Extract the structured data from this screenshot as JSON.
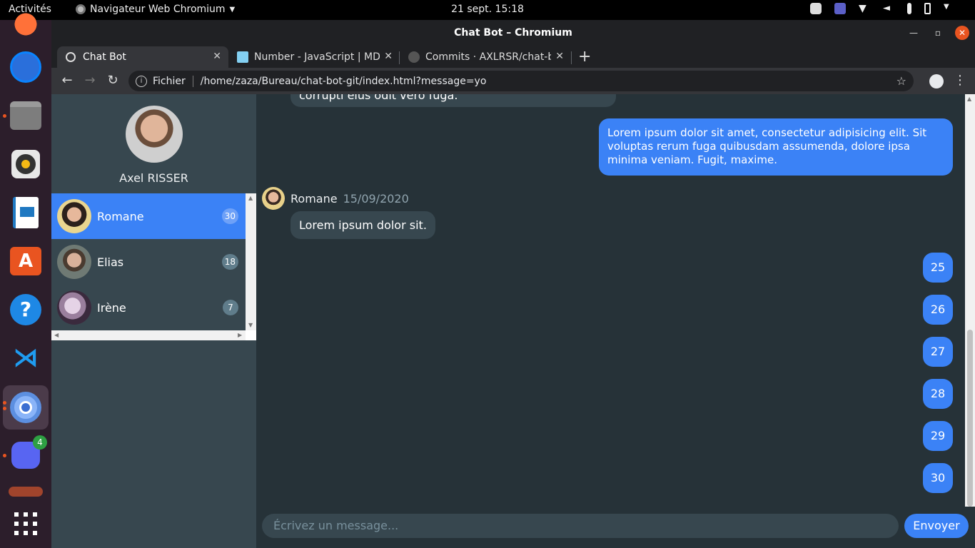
{
  "topbar": {
    "activities": "Activités",
    "app_name": "Navigateur Web Chromium",
    "clock": "21 sept.  15:18"
  },
  "dock": {
    "discord_badge": "4"
  },
  "window": {
    "title": "Chat Bot – Chromium"
  },
  "tabs": [
    {
      "label": "Chat Bot"
    },
    {
      "label": "Number - JavaScript | MDN"
    },
    {
      "label": "Commits · AXLRSR/chat-b"
    }
  ],
  "omnibox": {
    "scheme": "Fichier",
    "url": "/home/zaza/Bureau/chat-bot-git/index.html?message=yo"
  },
  "profile": {
    "name": "Axel RISSER"
  },
  "contacts": [
    {
      "name": "Romane",
      "count": "30"
    },
    {
      "name": "Elias",
      "count": "18"
    },
    {
      "name": "Irène",
      "count": "7"
    }
  ],
  "chat": {
    "partial_message": "corrupti eius odit vero fuga.",
    "my_message": "Lorem ipsum dolor sit amet, consectetur adipisicing elit. Sit voluptas rerum fuga quibusdam assumenda, dolore ipsa minima veniam. Fugit, maxime.",
    "sender_name": "Romane",
    "sender_date": "15/09/2020",
    "their_message": "Lorem ipsum dolor sit.",
    "numbers": [
      "25",
      "26",
      "27",
      "28",
      "29",
      "30"
    ]
  },
  "composer": {
    "placeholder": "Écrivez un message...",
    "send_label": "Envoyer"
  }
}
